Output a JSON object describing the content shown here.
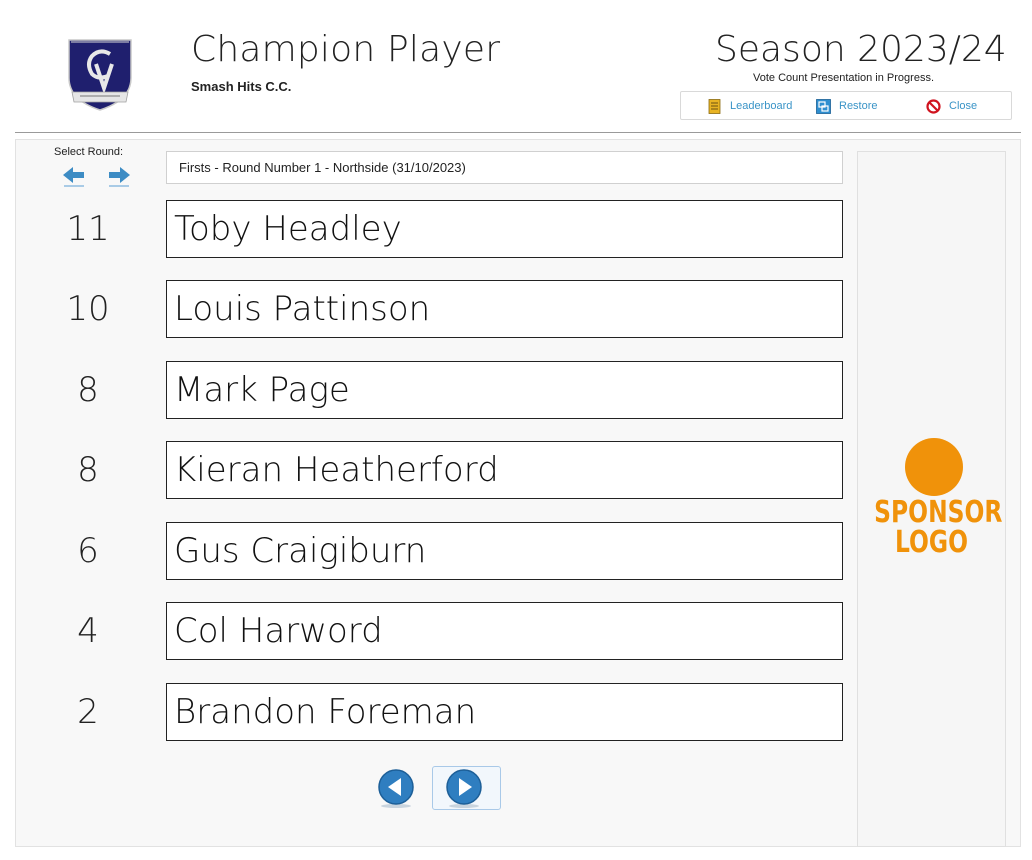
{
  "header": {
    "app_title": "Champion Player",
    "club_name": "Smash Hits C.C.",
    "season_title": "Season 2023/24",
    "status_text": "Vote Count Presentation in Progress.",
    "logo_icon": "club-crest-icon",
    "toolbar": {
      "leaderboard_label": "Leaderboard",
      "leaderboard_icon": "leaderboard-icon",
      "restore_label": "Restore",
      "restore_icon": "restore-icon",
      "close_label": "Close",
      "close_icon": "close-icon"
    }
  },
  "round_selector": {
    "label": "Select Round:",
    "prev_icon": "arrow-left-icon",
    "next_icon": "arrow-right-icon",
    "current_round": "Firsts - Round Number 1 - Northside (31/10/2023)"
  },
  "votes": [
    {
      "points": "11",
      "player": "Toby Headley"
    },
    {
      "points": "10",
      "player": "Louis Pattinson"
    },
    {
      "points": "8",
      "player": "Mark Page"
    },
    {
      "points": "8",
      "player": "Kieran Heatherford"
    },
    {
      "points": "6",
      "player": "Gus Craigiburn"
    },
    {
      "points": "4",
      "player": "Col Harword"
    },
    {
      "points": "2",
      "player": "Brandon Foreman"
    }
  ],
  "sponsor": {
    "line1": "SPONSOR",
    "line2": "LOGO",
    "color": "#f0920a"
  },
  "navigation": {
    "prev_icon": "circle-arrow-left-icon",
    "next_icon": "circle-arrow-right-icon"
  },
  "colors": {
    "accent": "#3a94c7",
    "sponsor": "#f0920a",
    "crest_navy": "#1f1f6e"
  }
}
